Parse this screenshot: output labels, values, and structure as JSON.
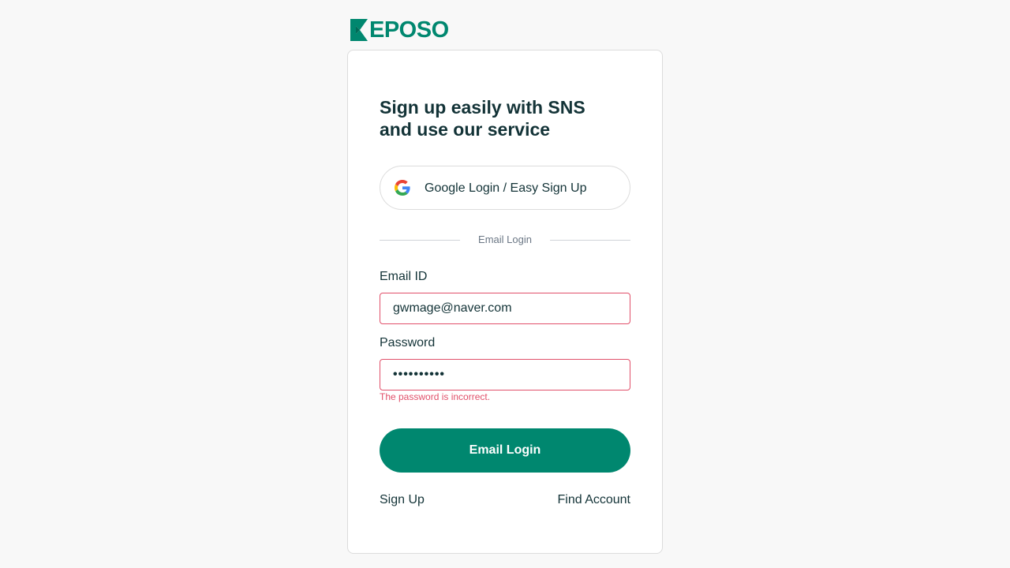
{
  "brand": {
    "name": "EPOSO",
    "color": "#00876f"
  },
  "headline": {
    "line1": "Sign up easily with SNS",
    "line2": "and use our service"
  },
  "google_button": {
    "label": "Google Login / Easy Sign Up",
    "icon": "google-icon"
  },
  "divider": {
    "label": "Email Login"
  },
  "email": {
    "label": "Email ID",
    "value": "gwmage@naver.com"
  },
  "password": {
    "label": "Password",
    "value": "••••••••••",
    "error": "The password is incorrect."
  },
  "login_button": {
    "label": "Email Login"
  },
  "links": {
    "sign_up": "Sign Up",
    "find_account": "Find Account"
  },
  "colors": {
    "accent": "#00876f",
    "error": "#e1506a",
    "text": "#133337"
  }
}
